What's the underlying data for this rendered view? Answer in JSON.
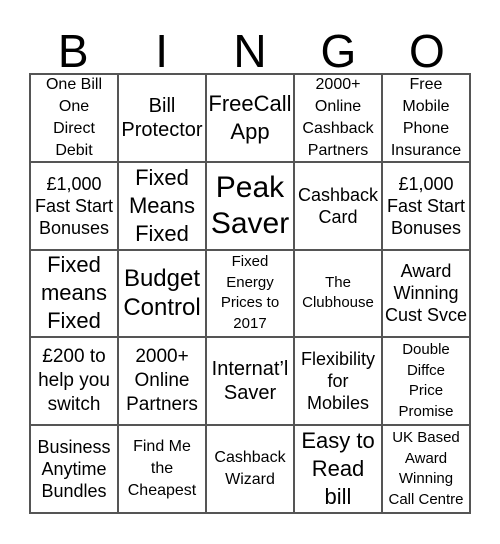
{
  "header": [
    "B",
    "I",
    "N",
    "G",
    "O"
  ],
  "cells": [
    [
      "One Bill\nOne\nDirect\nDebit",
      "Bill\nProtector",
      "FreeCall\nApp",
      "2000+\nOnline\nCashback\nPartners",
      "Free\nMobile\nPhone\nInsurance"
    ],
    [
      "£1,000\nFast Start\nBonuses",
      "Fixed\nMeans\nFixed",
      "Peak\nSaver",
      "Cashback\nCard",
      "£1,000\nFast Start\nBonuses"
    ],
    [
      "Fixed\nmeans\nFixed",
      "Budget\nControl",
      "Fixed\nEnergy\nPrices to\n2017",
      "The\nClubhouse",
      "Award\nWinning\nCust Svce"
    ],
    [
      "£200 to\nhelp you\nswitch",
      "2000+\nOnline\nPartners",
      "Internat’l\nSaver",
      "Flexibility\nfor\nMobiles",
      "Double\nDiffce\nPrice\nPromise"
    ],
    [
      "Business\nAnytime\nBundles",
      "Find Me\nthe\nCheapest",
      "Cashback\nWizard",
      "Easy to\nRead\nbill",
      "UK Based\nAward\nWinning\nCall Centre"
    ]
  ]
}
